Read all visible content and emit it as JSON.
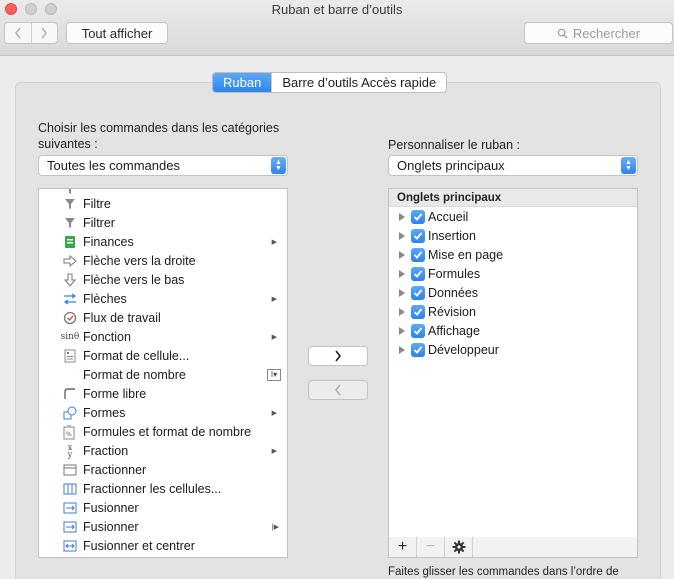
{
  "window": {
    "title": "Ruban et barre d’outils"
  },
  "toolbar": {
    "show_all": "Tout afficher",
    "search_placeholder": "Rechercher"
  },
  "tabs": [
    {
      "label": "Ruban",
      "active": true
    },
    {
      "label": "Barre d’outils Accès rapide",
      "active": false
    }
  ],
  "left": {
    "label": "Choisir les commandes dans les catégories suivantes :",
    "popup_value": "Toutes les commandes",
    "items": [
      {
        "label": "Filtre",
        "icon": "funnel-icon",
        "submenu": false
      },
      {
        "label": "Filtrer",
        "icon": "funnel-icon",
        "submenu": false
      },
      {
        "label": "Finances",
        "icon": "finance-book-icon",
        "submenu": true
      },
      {
        "label": "Flèche vers la droite",
        "icon": "arrow-right-icon",
        "submenu": false
      },
      {
        "label": "Flèche vers le bas",
        "icon": "arrow-down-icon",
        "submenu": false
      },
      {
        "label": "Flèches",
        "icon": "arrows-icon",
        "submenu": true
      },
      {
        "label": "Flux de travail",
        "icon": "workflow-icon",
        "submenu": false
      },
      {
        "label": "Fonction",
        "icon": "function-icon",
        "submenu": true
      },
      {
        "label": "Format de cellule...",
        "icon": "format-cell-icon",
        "submenu": false
      },
      {
        "label": "Format de nombre",
        "icon": "",
        "submenu": false,
        "control": "number-format-control-icon"
      },
      {
        "label": "Forme libre",
        "icon": "freeform-icon",
        "submenu": false
      },
      {
        "label": "Formes",
        "icon": "shapes-icon",
        "submenu": true
      },
      {
        "label": "Formules et format de nombre",
        "icon": "paste-formula-icon",
        "submenu": false
      },
      {
        "label": "Fraction",
        "icon": "fraction-icon",
        "submenu": true
      },
      {
        "label": "Fractionner",
        "icon": "split-icon",
        "submenu": false
      },
      {
        "label": "Fractionner les cellules...",
        "icon": "split-cells-icon",
        "submenu": false
      },
      {
        "label": "Fusionner",
        "icon": "merge-icon",
        "submenu": false
      },
      {
        "label": "Fusionner",
        "icon": "merge-icon",
        "submenu": true
      },
      {
        "label": "Fusionner et centrer",
        "icon": "merge-center-icon",
        "submenu": false
      }
    ]
  },
  "right": {
    "label": "Personnaliser le ruban :",
    "popup_value": "Onglets principaux",
    "header": "Onglets principaux",
    "items": [
      {
        "label": "Accueil",
        "checked": true
      },
      {
        "label": "Insertion",
        "checked": true
      },
      {
        "label": "Mise en page",
        "checked": true
      },
      {
        "label": "Formules",
        "checked": true
      },
      {
        "label": "Données",
        "checked": true
      },
      {
        "label": "Révision",
        "checked": true
      },
      {
        "label": "Affichage",
        "checked": true
      },
      {
        "label": "Développeur",
        "checked": true
      }
    ],
    "footer_buttons": [
      "+",
      "−"
    ],
    "hint": "Faites glisser les commandes dans l’ordre de"
  },
  "middle": {
    "add_symbol": "›",
    "remove_symbol": "‹"
  },
  "colors": {
    "accent": "#2c86ee",
    "close": "#fc605b"
  }
}
